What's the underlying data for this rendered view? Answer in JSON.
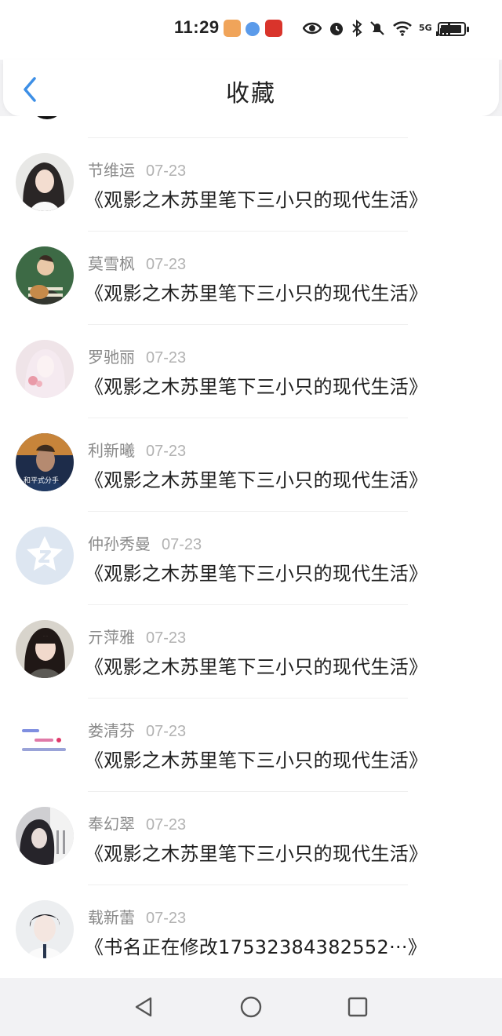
{
  "status_bar": {
    "time": "11:29",
    "icons": [
      "eye-icon",
      "alarm-icon",
      "bluetooth-icon",
      "mute-icon",
      "wifi-icon",
      "5g-signal-icon",
      "battery-icon"
    ],
    "network_label": "5G"
  },
  "header": {
    "title": "收藏",
    "back_icon": "chevron-left-icon",
    "accent_color": "#3d8fe6"
  },
  "favorites": [
    {
      "name": "节维运",
      "date": "07-23",
      "book": "《观影之木苏里笔下三小只的现代生活》"
    },
    {
      "name": "莫雪枫",
      "date": "07-23",
      "book": "《观影之木苏里笔下三小只的现代生活》"
    },
    {
      "name": "罗驰丽",
      "date": "07-23",
      "book": "《观影之木苏里笔下三小只的现代生活》"
    },
    {
      "name": "利新曦",
      "date": "07-23",
      "book": "《观影之木苏里笔下三小只的现代生活》",
      "avatar_caption": "和平式分手"
    },
    {
      "name": "仲孙秀曼",
      "date": "07-23",
      "book": "《观影之木苏里笔下三小只的现代生活》"
    },
    {
      "name": "亓萍雅",
      "date": "07-23",
      "book": "《观影之木苏里笔下三小只的现代生活》"
    },
    {
      "name": "娄清芬",
      "date": "07-23",
      "book": "《观影之木苏里笔下三小只的现代生活》"
    },
    {
      "name": "奉幻翠",
      "date": "07-23",
      "book": "《观影之木苏里笔下三小只的现代生活》"
    },
    {
      "name": "载新蕾",
      "date": "07-23",
      "book": "《书名正在修改17532384382552···》"
    }
  ],
  "nav_bar": {
    "buttons": [
      "back-triangle-icon",
      "home-circle-icon",
      "recents-square-icon"
    ]
  }
}
